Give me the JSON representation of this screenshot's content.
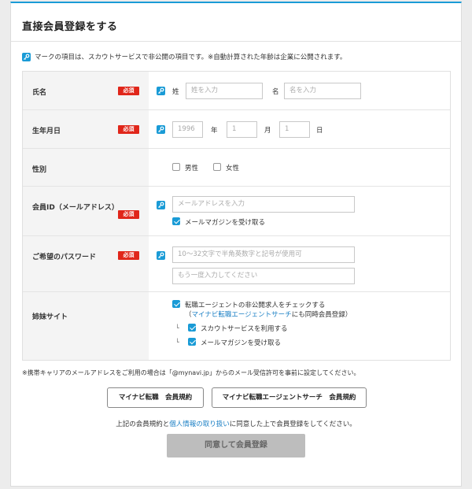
{
  "title": "直接会員登録をする",
  "notice": "マークの項目は、スカウトサービスで非公開の項目です。※自動計算された年齢は企業に公開されます。",
  "required_badge": "必須",
  "name_row": {
    "label": "氏名",
    "last_label": "姓",
    "last_placeholder": "姓を入力",
    "first_label": "名",
    "first_placeholder": "名を入力"
  },
  "birth_row": {
    "label": "生年月日",
    "year_value": "1996",
    "year_unit": "年",
    "month_value": "1",
    "month_unit": "月",
    "day_value": "1",
    "day_unit": "日"
  },
  "gender_row": {
    "label": "性別",
    "male": "男性",
    "female": "女性"
  },
  "email_row": {
    "label": "会員ID（メールアドレス）",
    "placeholder": "メールアドレスを入力",
    "newsletter": "メールマガジンを受け取る"
  },
  "password_row": {
    "label": "ご希望のパスワード",
    "placeholder": "10〜32文字で半角英数字と記号が使用可",
    "confirm_placeholder": "もう一度入力してください"
  },
  "sister_row": {
    "label": "姉妹サイト",
    "check_main": "転職エージェントの非公開求人をチェックする",
    "sub_paren_open": "（",
    "sub_link": "マイナビ転職エージェントサーチ",
    "sub_rest": "にも同時会員登録）",
    "branch_mark": "└",
    "scout": "スカウトサービスを利用する",
    "magazine": "メールマガジンを受け取る"
  },
  "footnote": "※携帯キャリアのメールアドレスをご利用の場合は「@mynavi.jp」からのメール受信許可を事前に設定してください。",
  "terms_button_1": "マイナビ転職　会員規約",
  "terms_button_2": "マイナビ転職エージェントサーチ　会員規約",
  "agree_pre": "上記の会員規約と",
  "agree_link": "個人情報の取り扱い",
  "agree_post": "に同意した上で会員登録をしてください。",
  "submit_label": "同意して会員登録",
  "colors": {
    "accent": "#1a9bd6",
    "required": "#e0261a",
    "disabled_button": "#bdbdbd"
  },
  "icons": {
    "private": "key-icon"
  }
}
